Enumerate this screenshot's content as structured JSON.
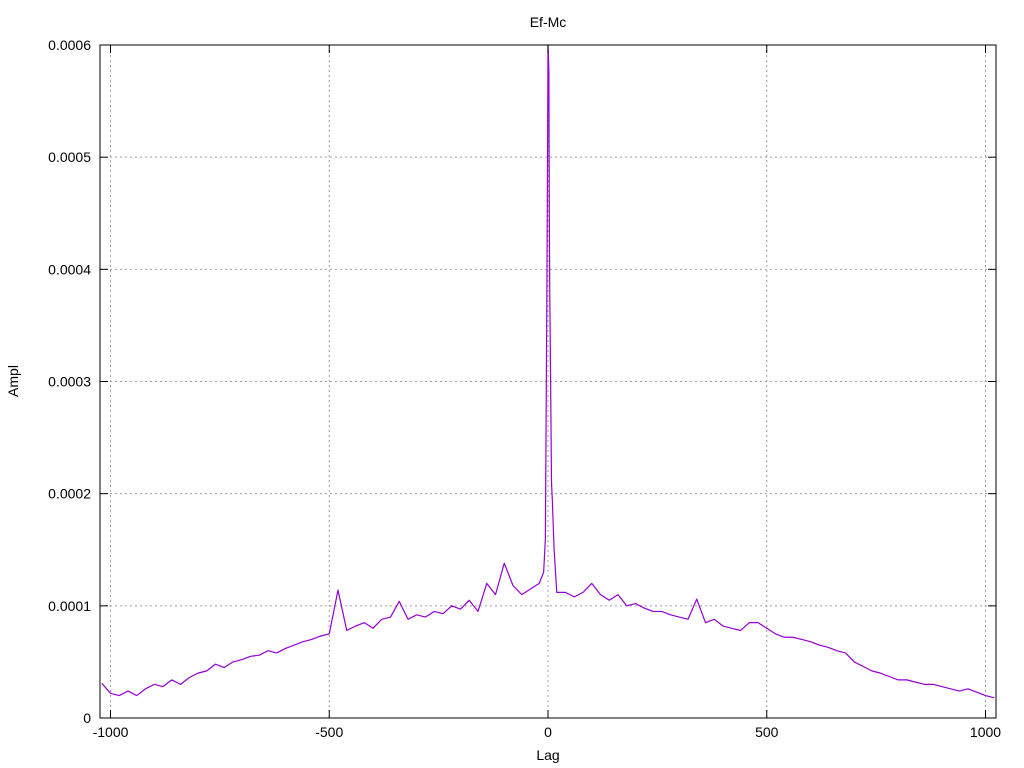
{
  "chart_data": {
    "type": "line",
    "title": "Ef-Mc",
    "xlabel": "Lag",
    "ylabel": "Ampl",
    "xlim": [
      -1024,
      1024
    ],
    "ylim": [
      0,
      0.0006
    ],
    "grid": true,
    "x_ticks": [
      {
        "value": -1000,
        "label": "-1000"
      },
      {
        "value": -500,
        "label": "-500"
      },
      {
        "value": 0,
        "label": "0"
      },
      {
        "value": 500,
        "label": "500"
      },
      {
        "value": 1000,
        "label": "1000"
      }
    ],
    "y_ticks": [
      {
        "value": 0,
        "label": "0"
      },
      {
        "value": 0.0001,
        "label": "0.0001"
      },
      {
        "value": 0.0002,
        "label": "0.0002"
      },
      {
        "value": 0.0003,
        "label": "0.0003"
      },
      {
        "value": 0.0004,
        "label": "0.0004"
      },
      {
        "value": 0.0005,
        "label": "0.0005"
      },
      {
        "value": 0.0006,
        "label": "0.0006"
      }
    ],
    "line_color": "#9400d3",
    "series": [
      {
        "x": [
          -1020,
          -1000,
          -980,
          -960,
          -940,
          -920,
          -900,
          -880,
          -860,
          -840,
          -820,
          -800,
          -780,
          -760,
          -740,
          -720,
          -700,
          -680,
          -660,
          -640,
          -620,
          -600,
          -580,
          -560,
          -540,
          -520,
          -500,
          -480,
          -460,
          -440,
          -420,
          -400,
          -380,
          -360,
          -340,
          -320,
          -300,
          -280,
          -260,
          -240,
          -220,
          -200,
          -180,
          -160,
          -140,
          -120,
          -100,
          -80,
          -60,
          -40,
          -20,
          -10,
          -6,
          -3,
          -1,
          0,
          1,
          2,
          3,
          4,
          6,
          8,
          10,
          14,
          20,
          40,
          60,
          80,
          100,
          120,
          140,
          160,
          180,
          200,
          220,
          240,
          260,
          280,
          300,
          320,
          340,
          360,
          380,
          400,
          420,
          440,
          460,
          480,
          500,
          520,
          540,
          560,
          580,
          600,
          620,
          640,
          660,
          680,
          700,
          720,
          740,
          760,
          780,
          800,
          820,
          840,
          860,
          880,
          900,
          920,
          940,
          960,
          980,
          1000,
          1020
        ],
        "y": [
          3.1e-05,
          2.2e-05,
          2e-05,
          2.4e-05,
          2e-05,
          2.6e-05,
          3e-05,
          2.8e-05,
          3.4e-05,
          3e-05,
          3.6e-05,
          4e-05,
          4.2e-05,
          4.8e-05,
          4.5e-05,
          5e-05,
          5.2e-05,
          5.5e-05,
          5.6e-05,
          6e-05,
          5.8e-05,
          6.2e-05,
          6.5e-05,
          6.8e-05,
          7e-05,
          7.3e-05,
          7.5e-05,
          0.000114,
          7.8e-05,
          8.2e-05,
          8.5e-05,
          8e-05,
          8.8e-05,
          9e-05,
          0.000104,
          8.8e-05,
          9.2e-05,
          9e-05,
          9.5e-05,
          9.3e-05,
          0.0001,
          9.7e-05,
          0.000105,
          9.5e-05,
          0.00012,
          0.00011,
          0.000138,
          0.000118,
          0.00011,
          0.000115,
          0.00012,
          0.00013,
          0.00016,
          0.00035,
          0.0005,
          0.0006,
          0.00059,
          0.000575,
          0.00045,
          0.00038,
          0.0003,
          0.00021,
          0.000193,
          0.00015,
          0.000112,
          0.000112,
          0.000108,
          0.000112,
          0.00012,
          0.00011,
          0.000105,
          0.00011,
          0.0001,
          0.000102,
          9.8e-05,
          9.5e-05,
          9.5e-05,
          9.2e-05,
          9e-05,
          8.8e-05,
          0.000106,
          8.5e-05,
          8.8e-05,
          8.2e-05,
          8e-05,
          7.8e-05,
          8.5e-05,
          8.5e-05,
          8e-05,
          7.5e-05,
          7.2e-05,
          7.2e-05,
          7e-05,
          6.8e-05,
          6.5e-05,
          6.3e-05,
          6e-05,
          5.8e-05,
          5e-05,
          4.6e-05,
          4.2e-05,
          4e-05,
          3.7e-05,
          3.4e-05,
          3.4e-05,
          3.2e-05,
          3e-05,
          3e-05,
          2.8e-05,
          2.6e-05,
          2.4e-05,
          2.6e-05,
          2.3e-05,
          2e-05,
          1.8e-05
        ]
      }
    ]
  }
}
